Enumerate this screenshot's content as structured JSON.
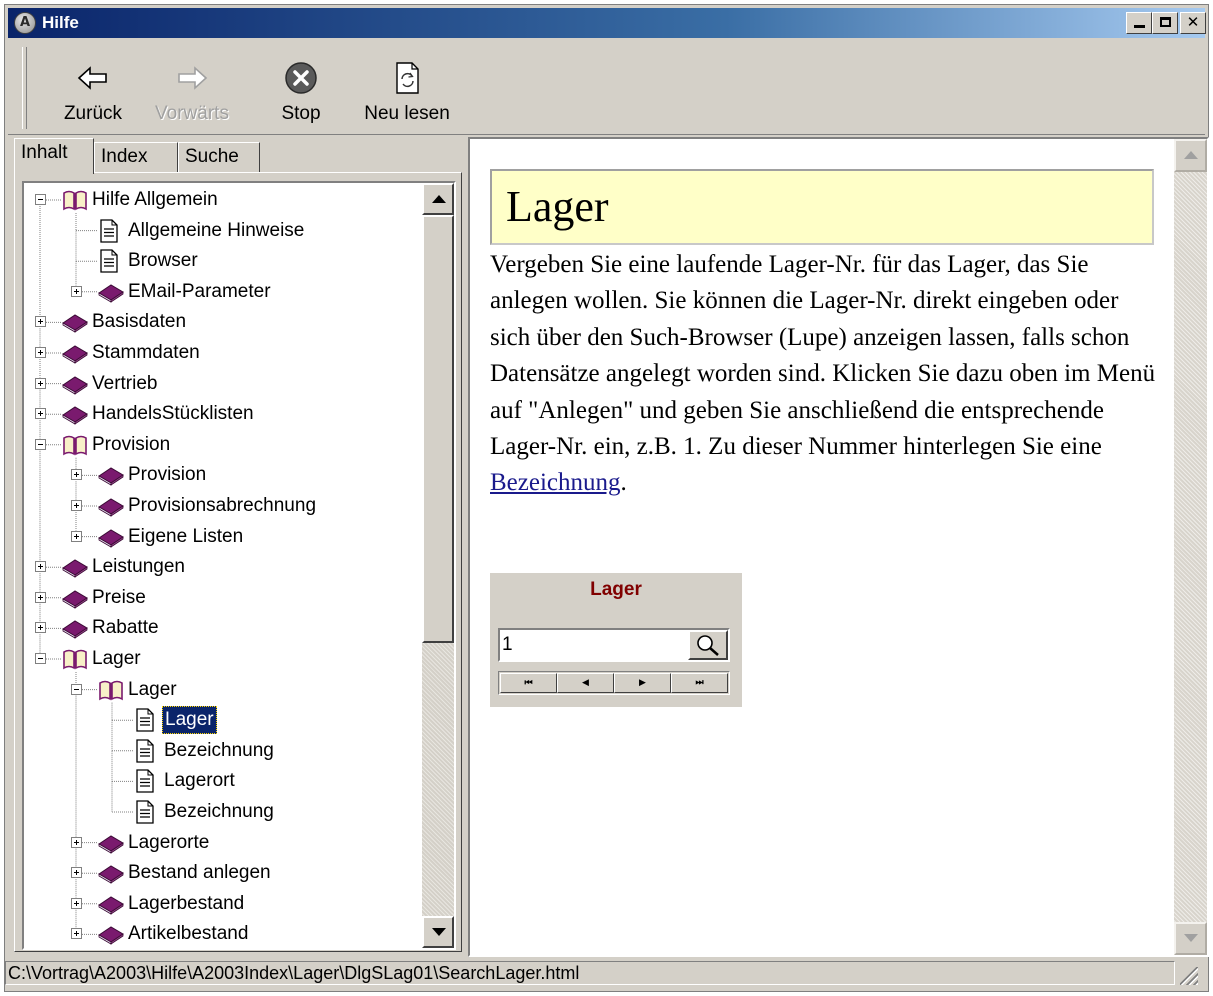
{
  "window": {
    "title": "Hilfe",
    "app_icon_letter": "A",
    "controls": {
      "minimize": "minimize-icon",
      "maximize": "maximize-icon",
      "close": "close-icon"
    }
  },
  "toolbar": {
    "back_label": "Zurück",
    "forward_label": "Vorwärts",
    "stop_label": "Stop",
    "refresh_label": "Neu lesen"
  },
  "tabs": {
    "inhalt": "Inhalt",
    "index": "Index",
    "suche": "Suche",
    "active": "Inhalt"
  },
  "tree": {
    "items": [
      {
        "label": "Hilfe Allgemein",
        "type": "book-open",
        "level": 0,
        "expanded": true
      },
      {
        "label": "Allgemeine Hinweise",
        "type": "page",
        "level": 1
      },
      {
        "label": "Browser",
        "type": "page",
        "level": 1
      },
      {
        "label": "EMail-Parameter",
        "type": "book",
        "level": 1,
        "expanded": false
      },
      {
        "label": "Basisdaten",
        "type": "book",
        "level": 0,
        "expanded": false
      },
      {
        "label": "Stammdaten",
        "type": "book",
        "level": 0,
        "expanded": false
      },
      {
        "label": "Vertrieb",
        "type": "book",
        "level": 0,
        "expanded": false
      },
      {
        "label": "HandelsStücklisten",
        "type": "book",
        "level": 0,
        "expanded": false
      },
      {
        "label": "Provision",
        "type": "book-open",
        "level": 0,
        "expanded": true
      },
      {
        "label": "Provision",
        "type": "book",
        "level": 1,
        "expanded": false
      },
      {
        "label": "Provisionsabrechnung",
        "type": "book",
        "level": 1,
        "expanded": false
      },
      {
        "label": "Eigene Listen",
        "type": "book",
        "level": 1,
        "expanded": false
      },
      {
        "label": "Leistungen",
        "type": "book",
        "level": 0,
        "expanded": false
      },
      {
        "label": "Preise",
        "type": "book",
        "level": 0,
        "expanded": false
      },
      {
        "label": "Rabatte",
        "type": "book",
        "level": 0,
        "expanded": false
      },
      {
        "label": "Lager",
        "type": "book-open",
        "level": 0,
        "expanded": true
      },
      {
        "label": "Lager",
        "type": "book-open",
        "level": 1,
        "expanded": true
      },
      {
        "label": "Lager",
        "type": "page",
        "level": 2,
        "selected": true
      },
      {
        "label": "Bezeichnung",
        "type": "page",
        "level": 2
      },
      {
        "label": "Lagerort",
        "type": "page",
        "level": 2
      },
      {
        "label": "Bezeichnung",
        "type": "page",
        "level": 2
      },
      {
        "label": "Lagerorte",
        "type": "book",
        "level": 1,
        "expanded": false
      },
      {
        "label": "Bestand anlegen",
        "type": "book",
        "level": 1,
        "expanded": false
      },
      {
        "label": "Lagerbestand",
        "type": "book",
        "level": 1,
        "expanded": false
      },
      {
        "label": "Artikelbestand",
        "type": "book",
        "level": 1,
        "expanded": false
      }
    ]
  },
  "content": {
    "heading": "Lager",
    "paragraph_text": "Vergeben Sie eine laufende Lager-Nr. für das Lager, das Sie anlegen wollen. Sie können die Lager-Nr. direkt eingeben oder sich über den Such-Browser (Lupe) anzeigen lassen, falls schon Datensätze angelegt worden sind. Klicken Sie dazu oben im Menü auf \"Anlegen\" und geben Sie anschließend die entsprechende Lager-Nr. ein, z.B. 1. Zu dieser Nummer hinterlegen Sie eine",
    "link_text": "Bezeichnung",
    "paragraph_end": ".",
    "preview": {
      "title": "Lager",
      "input_value": "1",
      "search_icon": "magnifier-icon",
      "nav_buttons": [
        "first-record-icon",
        "previous-record-icon",
        "next-record-icon",
        "last-record-icon"
      ]
    }
  },
  "status": {
    "path": "C:\\Vortrag\\A2003\\Hilfe\\A2003Index\\Lager\\DlgSLag01\\SearchLager.html"
  },
  "colors": {
    "titlebar_start": "#0a246a",
    "titlebar_end": "#a6caf0",
    "heading_bg": "#ffffc8",
    "book": "#7a1a6e",
    "link": "#1a1a8c",
    "preview_title": "#800000",
    "selection": "#0a246a"
  }
}
